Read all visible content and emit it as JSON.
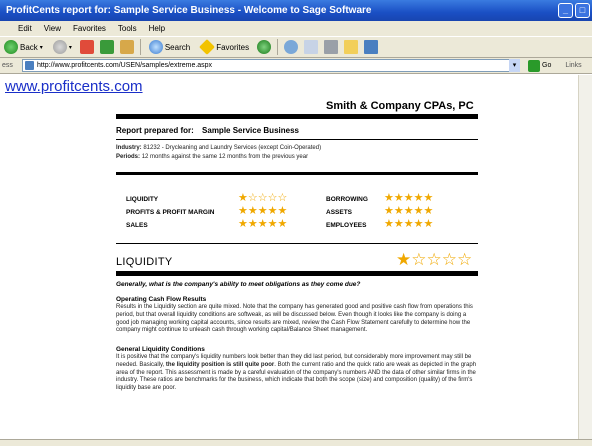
{
  "window": {
    "title": "ProfitCents report for: Sample Service Business - Welcome to Sage Software"
  },
  "menu": [
    "Edit",
    "View",
    "Favorites",
    "Tools",
    "Help"
  ],
  "toolbar": {
    "back_label": "Back",
    "search_label": "Search",
    "favorites_label": "Favorites"
  },
  "address": {
    "label": "ess",
    "url": "http://www.profitcents.com/USEN/samples/extreme.aspx",
    "go_label": "Go",
    "links_label": "Links"
  },
  "page": {
    "site_link": "www.profitcents.com",
    "firm_name": "Smith & Company CPAs, PC",
    "prepared_label": "Report prepared for:",
    "prepared_name": "Sample Service Business",
    "industry_label": "Industry:",
    "industry_value": "81232 - Drycleaning and Laundry Services (except Coin-Operated)",
    "periods_label": "Periods:",
    "periods_value": "12 months against the same 12 months from the previous year",
    "ratings": [
      {
        "label": "LIQUIDITY",
        "stars": 1,
        "max": 5
      },
      {
        "label": "PROFITS & PROFIT MARGIN",
        "stars": 5,
        "max": 5
      },
      {
        "label": "SALES",
        "stars": 5,
        "max": 5
      },
      {
        "label": "BORROWING",
        "stars": 5,
        "max": 5
      },
      {
        "label": "ASSETS",
        "stars": 5,
        "max": 5
      },
      {
        "label": "EMPLOYEES",
        "stars": 5,
        "max": 5
      }
    ],
    "section": {
      "title": "LIQUIDITY",
      "stars": 1,
      "max": 5,
      "question": "Generally, what is the company's ability to meet obligations as they come due?",
      "h1": "Operating Cash Flow Results",
      "p1": "Results in the Liquidity section are quite mixed. Note that the company has generated good and positive cash flow from operations this period, but that overall liquidity conditions are softweak, as will be discussed below. Even though it looks like the company is doing a good job managing working capital accounts, since results are mixed, review the Cash Flow Statement carefully to determine how the company might continue to unleash cash through working capital/Balance Sheet management.",
      "h2": "General Liquidity Conditions",
      "p2_a": "It is positive that the company's liquidity numbers look better than they did last period, but considerably more improvement may still be needed. Basically, ",
      "p2_bold": "the liquidity position is still quite poor",
      "p2_b": ". Both the current ratio and the quick ratio are weak as depicted in the graph area of the report. This assessment is made by a careful evaluation of the company's numbers AND the data of other similar firms in the industry. These ratios are benchmarks for the business, which indicate that both the scope (size) and composition (quality) of the firm's liquidity base are poor."
    }
  },
  "colors": {
    "titlebar": "#1a4fc4",
    "chrome": "#ece9d8",
    "link": "#1a2fc8",
    "star": "#f0a800"
  }
}
